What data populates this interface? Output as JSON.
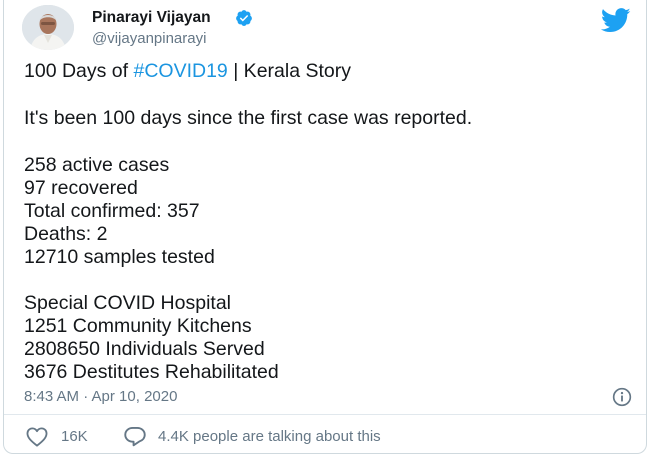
{
  "author": {
    "name": "Pinarayi Vijayan",
    "handle": "@vijayanpinarayi",
    "verified_icon": "verified-badge-icon",
    "avatar_icon": "profile-photo"
  },
  "brand": {
    "logo": "twitter-bird-icon",
    "color": "#1da1f2"
  },
  "tweet": {
    "line1_prefix": "100 Days of ",
    "hashtag": "#COVID19",
    "line1_suffix": " | Kerala Story",
    "intro": "It's been 100 days since the first case was reported.",
    "stats": [
      "258 active cases",
      "97 recovered",
      "Total confirmed: 357",
      "Deaths: 2",
      "12710 samples tested"
    ],
    "facts": [
      "Special COVID Hospital",
      "1251 Community Kitchens",
      "2808650 Individuals Served",
      "3676 Destitutes Rehabilitated"
    ],
    "timestamp": "8:43 AM · Apr 10, 2020"
  },
  "actions": {
    "likes": "16K",
    "talking": "4.4K people are talking about this",
    "info_icon": "info-icon",
    "like_icon": "heart-icon",
    "reply_icon": "speech-bubble-icon"
  },
  "colors": {
    "link": "#1b95e0",
    "muted": "#657786",
    "text": "#14171a"
  }
}
